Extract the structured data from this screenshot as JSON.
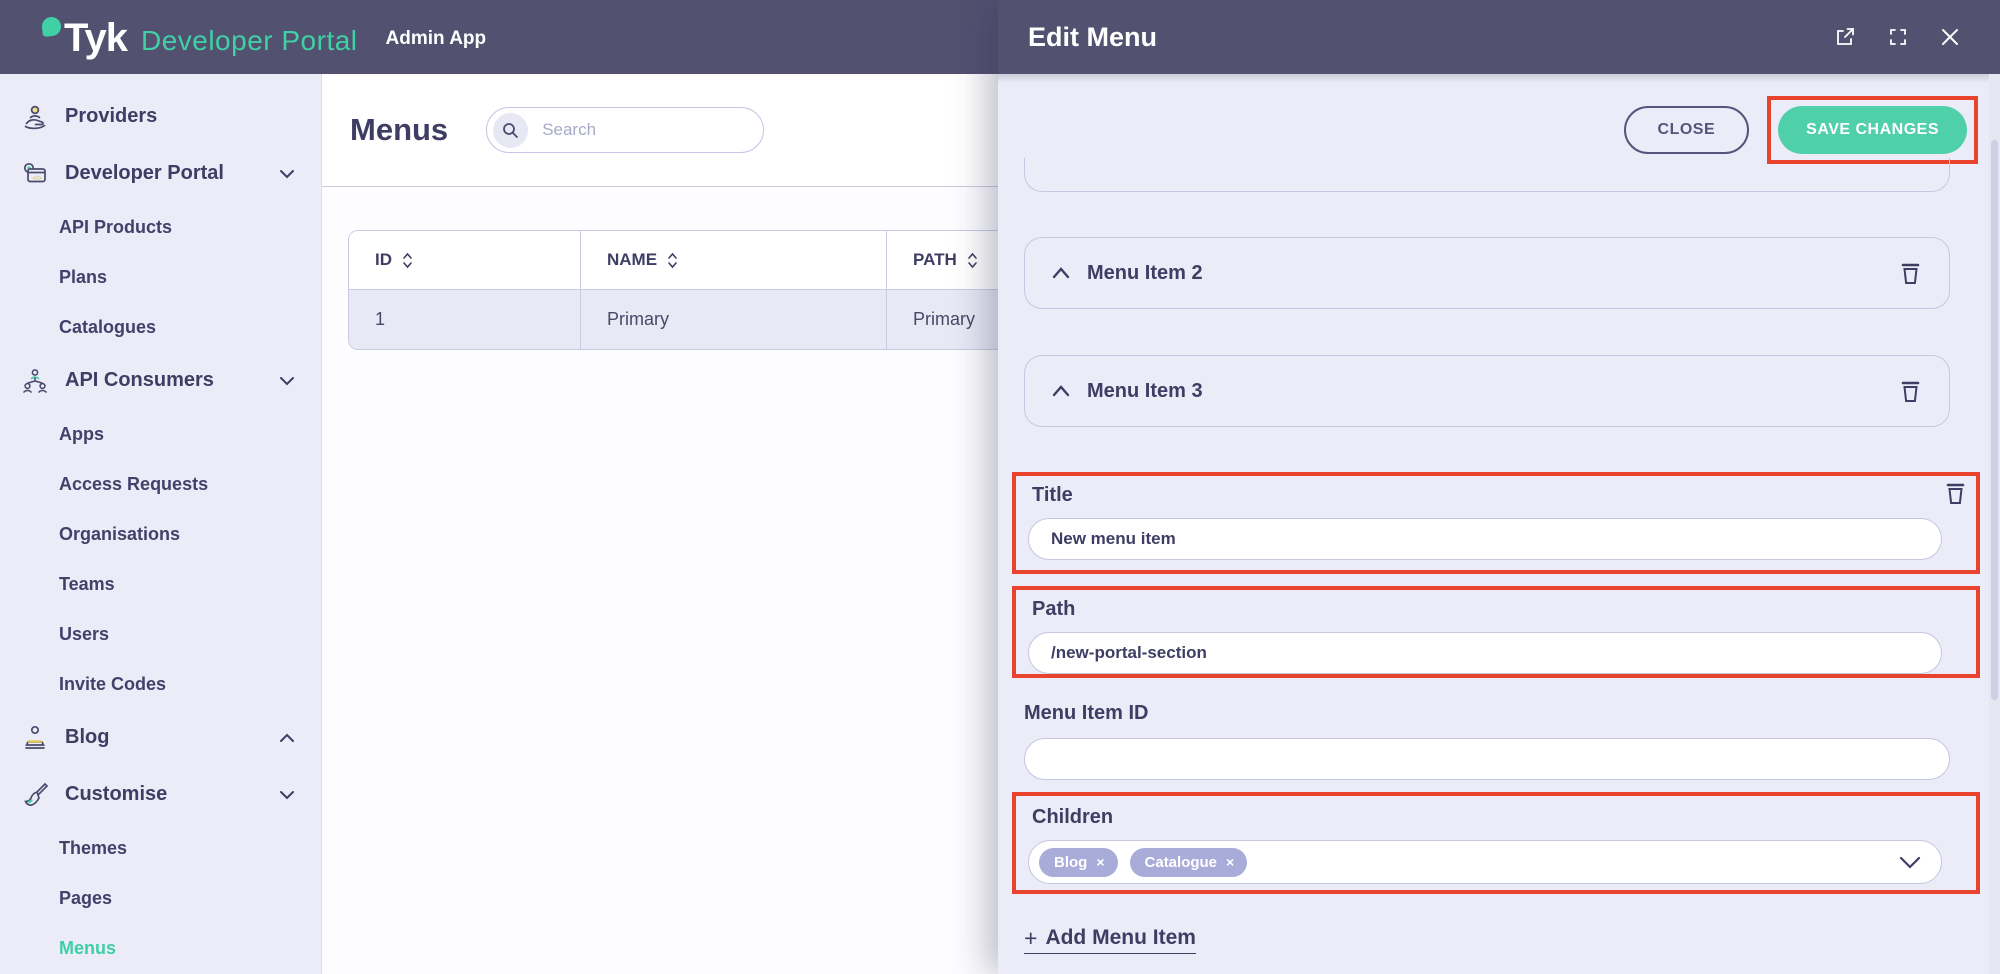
{
  "colors": {
    "header_bg": "#535170",
    "accent_teal": "#3fd1a5",
    "save_green": "#50cfab",
    "annotation_red": "#e8432c",
    "panel_bg": "#ebecf7",
    "text_navy": "#3f3d63",
    "tag_lavender": "#a9abd8"
  },
  "header": {
    "brand": "Tyk",
    "product": "Developer Portal",
    "app": "Admin App"
  },
  "sidebar": {
    "items": [
      {
        "label": "Providers"
      },
      {
        "label": "Developer Portal",
        "chevron": "down"
      },
      {
        "label": "API Products"
      },
      {
        "label": "Plans"
      },
      {
        "label": "Catalogues"
      },
      {
        "label": "API Consumers",
        "chevron": "down"
      },
      {
        "label": "Apps"
      },
      {
        "label": "Access Requests"
      },
      {
        "label": "Organisations"
      },
      {
        "label": "Teams"
      },
      {
        "label": "Users"
      },
      {
        "label": "Invite Codes"
      },
      {
        "label": "Blog",
        "chevron": "up"
      },
      {
        "label": "Customise",
        "chevron": "down"
      },
      {
        "label": "Themes"
      },
      {
        "label": "Pages"
      },
      {
        "label": "Menus",
        "active": true
      }
    ]
  },
  "main": {
    "title": "Menus",
    "search": {
      "placeholder": "Search"
    },
    "table": {
      "columns": [
        "ID",
        "NAME",
        "PATH"
      ],
      "rows": [
        {
          "id": "1",
          "name": "Primary",
          "path": "Primary"
        }
      ]
    }
  },
  "drawer": {
    "title": "Edit Menu",
    "buttons": {
      "close": "CLOSE",
      "save": "SAVE CHANGES"
    },
    "cards": [
      {
        "label": "Menu Item 2"
      },
      {
        "label": "Menu Item 3"
      }
    ],
    "fields": {
      "title": {
        "label": "Title",
        "value": "New menu item"
      },
      "path": {
        "label": "Path",
        "value": "/new-portal-section"
      },
      "menu_item_id": {
        "label": "Menu Item ID",
        "value": ""
      },
      "children": {
        "label": "Children",
        "tags": [
          {
            "label": "Blog"
          },
          {
            "label": "Catalogue"
          }
        ]
      }
    },
    "add_menu_item": {
      "plus": "+",
      "label": "Add Menu Item"
    }
  },
  "icons": {
    "remove_tag": "×"
  }
}
